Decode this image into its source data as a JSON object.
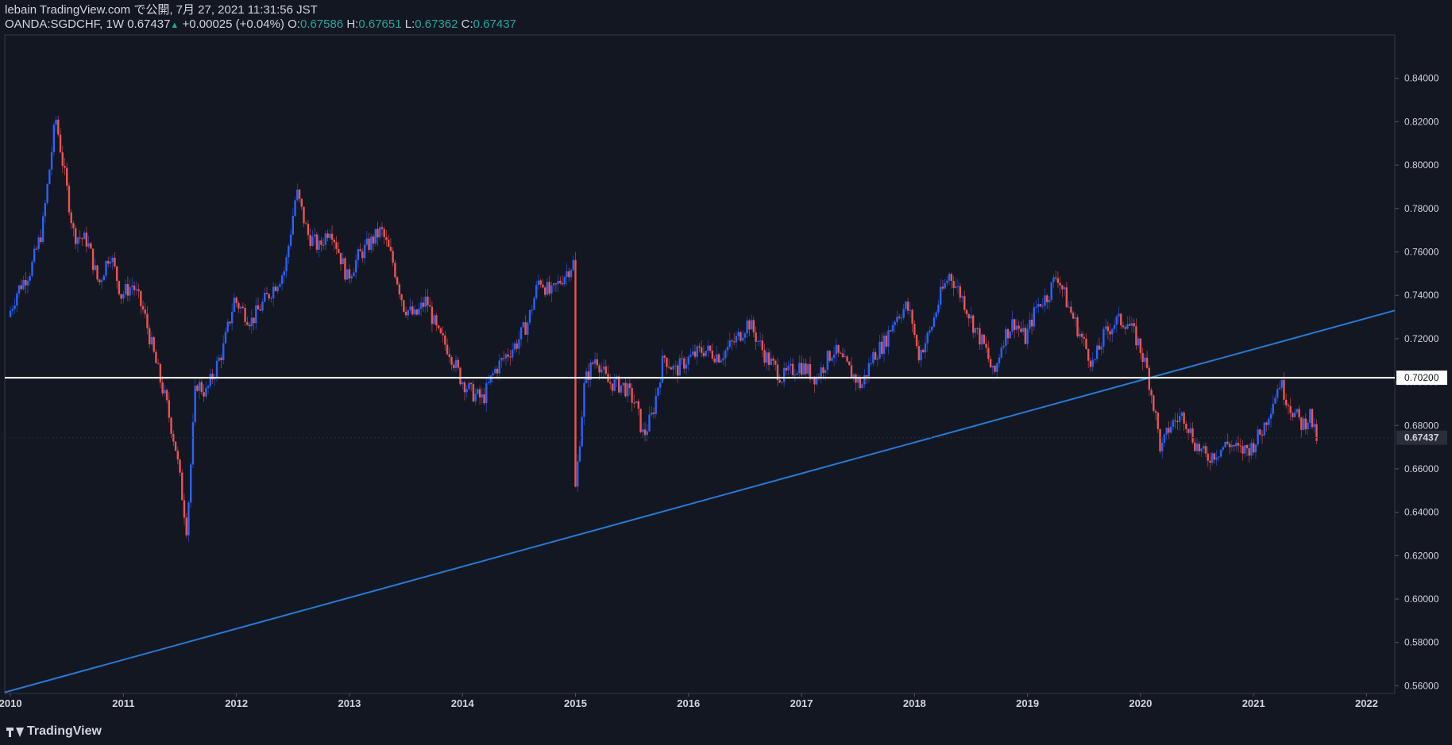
{
  "header": {
    "publish_line": "lebain TradingView.com で公開, 7月 27, 2021 11:31:56 JST",
    "symbol": "OANDA:SGDCHF, 1W",
    "last": "0.67437",
    "change": "+0.00025 (+0.04%)",
    "o_label": "O:",
    "o_value": "0.67586",
    "h_label": "H:",
    "h_value": "0.67651",
    "l_label": "L:",
    "l_value": "0.67362",
    "c_label": "C:",
    "c_value": "0.67437"
  },
  "footer": {
    "brand": "TradingView"
  },
  "colors": {
    "background": "#131722",
    "up": "#2962ff",
    "down": "#ef5350",
    "trendline": "#2979d4",
    "horizontal_line": "#ffffff",
    "text": "#d1d4dc",
    "header_value": "#26a69a"
  },
  "chart_data": {
    "type": "candlestick",
    "interval": "1W",
    "x_ticks": [
      "2010",
      "2011",
      "2012",
      "2013",
      "2014",
      "2015",
      "2016",
      "2017",
      "2018",
      "2019",
      "2020",
      "2021",
      "2022"
    ],
    "y_ticks": [
      "0.84000",
      "0.82000",
      "0.80000",
      "0.78000",
      "0.76000",
      "0.74000",
      "0.72000",
      "0.70000",
      "0.68000",
      "0.66000",
      "0.64000",
      "0.62000",
      "0.60000",
      "0.58000",
      "0.56000"
    ],
    "x_range": [
      2009.95,
      2022.25
    ],
    "y_range": [
      0.5565,
      0.86
    ],
    "horizontal_line": {
      "value": 0.702,
      "label": "0.70200"
    },
    "last_price": {
      "value": 0.67437,
      "label": "0.67437"
    },
    "trendline": {
      "start": [
        2009.95,
        0.557
      ],
      "end": [
        2022.25,
        0.733
      ]
    },
    "keypoints": [
      [
        2010.0,
        0.73
      ],
      [
        2010.08,
        0.742
      ],
      [
        2010.2,
        0.752
      ],
      [
        2010.3,
        0.77
      ],
      [
        2010.42,
        0.822
      ],
      [
        2010.5,
        0.795
      ],
      [
        2010.58,
        0.768
      ],
      [
        2010.7,
        0.765
      ],
      [
        2010.8,
        0.745
      ],
      [
        2010.9,
        0.76
      ],
      [
        2011.0,
        0.74
      ],
      [
        2011.1,
        0.745
      ],
      [
        2011.2,
        0.732
      ],
      [
        2011.3,
        0.71
      ],
      [
        2011.4,
        0.69
      ],
      [
        2011.48,
        0.67
      ],
      [
        2011.58,
        0.632
      ],
      [
        2011.66,
        0.7
      ],
      [
        2011.75,
        0.695
      ],
      [
        2011.9,
        0.715
      ],
      [
        2012.0,
        0.738
      ],
      [
        2012.15,
        0.728
      ],
      [
        2012.3,
        0.74
      ],
      [
        2012.45,
        0.752
      ],
      [
        2012.55,
        0.788
      ],
      [
        2012.65,
        0.768
      ],
      [
        2012.75,
        0.762
      ],
      [
        2012.85,
        0.772
      ],
      [
        2013.0,
        0.748
      ],
      [
        2013.1,
        0.758
      ],
      [
        2013.2,
        0.764
      ],
      [
        2013.3,
        0.77
      ],
      [
        2013.4,
        0.756
      ],
      [
        2013.5,
        0.735
      ],
      [
        2013.6,
        0.73
      ],
      [
        2013.7,
        0.738
      ],
      [
        2013.8,
        0.722
      ],
      [
        2013.9,
        0.715
      ],
      [
        2014.0,
        0.702
      ],
      [
        2014.1,
        0.695
      ],
      [
        2014.2,
        0.692
      ],
      [
        2014.3,
        0.705
      ],
      [
        2014.4,
        0.712
      ],
      [
        2014.5,
        0.718
      ],
      [
        2014.6,
        0.728
      ],
      [
        2014.7,
        0.748
      ],
      [
        2014.8,
        0.74
      ],
      [
        2014.9,
        0.748
      ],
      [
        2015.0,
        0.755
      ],
      [
        2015.01,
        0.645
      ],
      [
        2015.1,
        0.7
      ],
      [
        2015.2,
        0.712
      ],
      [
        2015.3,
        0.7
      ],
      [
        2015.45,
        0.698
      ],
      [
        2015.55,
        0.69
      ],
      [
        2015.62,
        0.675
      ],
      [
        2015.7,
        0.685
      ],
      [
        2015.8,
        0.712
      ],
      [
        2015.9,
        0.705
      ],
      [
        2016.0,
        0.71
      ],
      [
        2016.15,
        0.715
      ],
      [
        2016.3,
        0.712
      ],
      [
        2016.45,
        0.72
      ],
      [
        2016.55,
        0.728
      ],
      [
        2016.7,
        0.712
      ],
      [
        2016.85,
        0.702
      ],
      [
        2017.0,
        0.708
      ],
      [
        2017.15,
        0.702
      ],
      [
        2017.3,
        0.715
      ],
      [
        2017.45,
        0.705
      ],
      [
        2017.55,
        0.698
      ],
      [
        2017.65,
        0.712
      ],
      [
        2017.75,
        0.718
      ],
      [
        2017.85,
        0.73
      ],
      [
        2017.95,
        0.735
      ],
      [
        2018.0,
        0.728
      ],
      [
        2018.05,
        0.712
      ],
      [
        2018.15,
        0.722
      ],
      [
        2018.25,
        0.74
      ],
      [
        2018.33,
        0.75
      ],
      [
        2018.45,
        0.738
      ],
      [
        2018.55,
        0.725
      ],
      [
        2018.65,
        0.715
      ],
      [
        2018.72,
        0.702
      ],
      [
        2018.8,
        0.72
      ],
      [
        2018.9,
        0.728
      ],
      [
        2019.0,
        0.72
      ],
      [
        2019.1,
        0.735
      ],
      [
        2019.2,
        0.74
      ],
      [
        2019.28,
        0.75
      ],
      [
        2019.38,
        0.735
      ],
      [
        2019.5,
        0.72
      ],
      [
        2019.6,
        0.708
      ],
      [
        2019.7,
        0.722
      ],
      [
        2019.8,
        0.728
      ],
      [
        2019.9,
        0.728
      ],
      [
        2020.0,
        0.718
      ],
      [
        2020.08,
        0.705
      ],
      [
        2020.15,
        0.685
      ],
      [
        2020.2,
        0.668
      ],
      [
        2020.28,
        0.68
      ],
      [
        2020.4,
        0.685
      ],
      [
        2020.5,
        0.672
      ],
      [
        2020.6,
        0.665
      ],
      [
        2020.7,
        0.668
      ],
      [
        2020.8,
        0.672
      ],
      [
        2020.9,
        0.668
      ],
      [
        2021.0,
        0.67
      ],
      [
        2021.1,
        0.678
      ],
      [
        2021.18,
        0.69
      ],
      [
        2021.25,
        0.7
      ],
      [
        2021.35,
        0.688
      ],
      [
        2021.45,
        0.68
      ],
      [
        2021.52,
        0.685
      ],
      [
        2021.57,
        0.674
      ]
    ]
  }
}
